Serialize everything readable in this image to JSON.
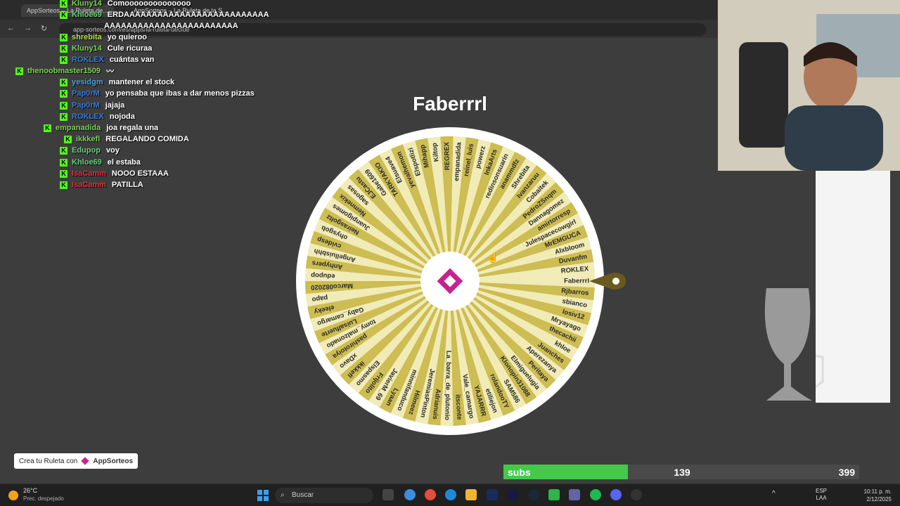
{
  "browser": {
    "tabs": [
      "AppSorteos – La Ruleta de...",
      "AppSorteos – La Ruleta de la S..."
    ],
    "url": "app-sorteos.com/es/apps/la-ruleta-decide"
  },
  "chat": [
    {
      "user": "Kluny14",
      "color": "#7cd356",
      "msg": "Comoooooooooooooo"
    },
    {
      "user": "Khloe69",
      "color": "#6ad07a",
      "msg": "ERDAAAAAAAAAAAAAAAAAAAAAAAAAA"
    },
    {
      "user": "",
      "color": "#ffffff",
      "msg": "AAAAAAAAAAAAAAAAAAAAAAAA"
    },
    {
      "user": "shrebita",
      "color": "#b8e04a",
      "msg": "yo quieroo"
    },
    {
      "user": "Kluny14",
      "color": "#7cd356",
      "msg": "Cule ricuraa"
    },
    {
      "user": "ROKLEX",
      "color": "#3a7bd5",
      "msg": "cuántas van"
    },
    {
      "user": "thenoobmaster1509",
      "color": "#7cd356",
      "msg": "〰"
    },
    {
      "user": "yesidgm",
      "color": "#4aa3df",
      "msg": "mantener el stock"
    },
    {
      "user": "Pap0rM",
      "color": "#3a7bd5",
      "msg": "yo pensaba que ibas a dar menos pizzas"
    },
    {
      "user": "Pap0rM",
      "color": "#3a7bd5",
      "msg": "jajaja"
    },
    {
      "user": "ROKLEX",
      "color": "#3a7bd5",
      "msg": "nojoda"
    },
    {
      "user": "empanadida",
      "color": "#7cd356",
      "msg": "joa regala una"
    },
    {
      "user": "ikkkefl",
      "color": "#7cd356",
      "msg": "REGALANDO COMIDA"
    },
    {
      "user": "Edupop",
      "color": "#6ad07a",
      "msg": "voy"
    },
    {
      "user": "Khloe69",
      "color": "#6ad07a",
      "msg": "el estaba"
    },
    {
      "user": "IsaCamm",
      "color": "#e0333c",
      "msg": "NOOO ESTAAA"
    },
    {
      "user": "IsaCamm",
      "color": "#e0333c",
      "msg": "PATILLA"
    }
  ],
  "wheel": {
    "winner": "Faberrrl",
    "names": [
      "Faberrrl",
      "Rjbarros",
      "sbianco",
      "losiv12",
      "Mryayago",
      "thecachii",
      "khloe",
      "Juanches",
      "Aperezanya",
      "Peritaya",
      "Elmiguelugia",
      "Klonopin31088",
      "SAM586",
      "rolandooTY",
      "etiliejon",
      "YAJARRR",
      "Vale_camargo",
      "itsconte",
      "La_barra_de_plutonio",
      "Adrianuis",
      "JeremiasPinton",
      "Hilmeez",
      "minnifanduco",
      "Lyaan",
      "JavierM_69",
      "Frijolito",
      "Elspasmo",
      "ikkkefl",
      "xDavo",
      "pashirotoiya",
      "tomy_malzonado",
      "Luisalfuerte",
      "Gaby_camargo",
      "eleeky",
      "papo",
      "Marco082020",
      "edupop",
      "Anhypers",
      "Angelluisbhh",
      "cvidesp",
      "ohysgob",
      "Neirasgoltz",
      "Juanpigomes",
      "Nemnekix",
      "sagosas",
      "EJCastu",
      "Gabe1609",
      "TARKYAKIO",
      "Elsuave4",
      "yevalhemon",
      "Elspotlizi",
      "Mihapp",
      "Kiltop",
      "REGREX",
      "empanadida",
      "reinel_luis",
      "powerz",
      "InkaArts",
      "redinsonsuarin",
      "anammdfz",
      "Shrebita",
      "Ivanzaruu",
      "Cobaitek",
      "PedroZSnqm",
      "Dannagomez",
      "amirtorresp",
      "Julespacecowgirl",
      "MrEMGUCA",
      "Alxbloom",
      "Duvanfm",
      "ROKLEX"
    ],
    "colors": [
      "#f1ebb8",
      "#cdbd52"
    ],
    "center_logo": "appsorteos-logo"
  },
  "cta": {
    "label": "Crea tu Ruleta con",
    "brand": "AppSorteos"
  },
  "subs": {
    "label": "subs",
    "current": "139",
    "goal": "399",
    "progress": 0.35
  },
  "taskbar": {
    "temp": "26°C",
    "weather": "Prec. despejado",
    "search": "Buscar",
    "lang1": "ESP",
    "lang2": "LAA",
    "time": "10:11 p. m.",
    "date": "2/12/2025"
  }
}
